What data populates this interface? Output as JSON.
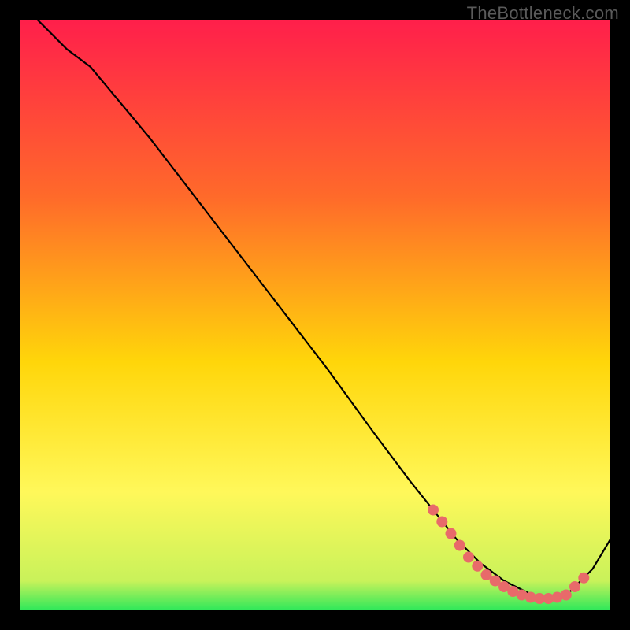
{
  "watermark": "TheBottleneck.com",
  "colors": {
    "bg": "#000000",
    "grad_top": "#ff1f4b",
    "grad_mid1": "#ff6a2a",
    "grad_mid2": "#ffd60a",
    "grad_low": "#fff85a",
    "grad_green": "#2ee85a",
    "curve": "#000000",
    "dot": "#e86a6a"
  },
  "chart_data": {
    "type": "line",
    "title": "",
    "xlabel": "",
    "ylabel": "",
    "xlim": [
      0,
      100
    ],
    "ylim": [
      0,
      100
    ],
    "series": [
      {
        "name": "curve",
        "x": [
          3,
          8,
          12,
          22,
          32,
          42,
          52,
          60,
          66,
          70,
          74,
          78,
          82,
          86,
          88,
          90,
          93,
          97,
          100
        ],
        "values": [
          100,
          95,
          92,
          80,
          67,
          54,
          41,
          30,
          22,
          17,
          12,
          8,
          5,
          3,
          2.2,
          2,
          3,
          7,
          12
        ]
      }
    ],
    "dots": [
      {
        "x": 70,
        "y": 17
      },
      {
        "x": 71.5,
        "y": 15
      },
      {
        "x": 73,
        "y": 13
      },
      {
        "x": 74.5,
        "y": 11
      },
      {
        "x": 76,
        "y": 9
      },
      {
        "x": 77.5,
        "y": 7.5
      },
      {
        "x": 79,
        "y": 6
      },
      {
        "x": 80.5,
        "y": 5
      },
      {
        "x": 82,
        "y": 4
      },
      {
        "x": 83.5,
        "y": 3.2
      },
      {
        "x": 85,
        "y": 2.6
      },
      {
        "x": 86.5,
        "y": 2.2
      },
      {
        "x": 88,
        "y": 2
      },
      {
        "x": 89.5,
        "y": 2
      },
      {
        "x": 91,
        "y": 2.2
      },
      {
        "x": 92.5,
        "y": 2.6
      },
      {
        "x": 94,
        "y": 4
      },
      {
        "x": 95.5,
        "y": 5.5
      }
    ],
    "gradient_stops": [
      {
        "offset": 0,
        "color": "#ff1f4b"
      },
      {
        "offset": 30,
        "color": "#ff6a2a"
      },
      {
        "offset": 58,
        "color": "#ffd60a"
      },
      {
        "offset": 80,
        "color": "#fff85a"
      },
      {
        "offset": 95,
        "color": "#c9f25a"
      },
      {
        "offset": 100,
        "color": "#2ee85a"
      }
    ]
  }
}
